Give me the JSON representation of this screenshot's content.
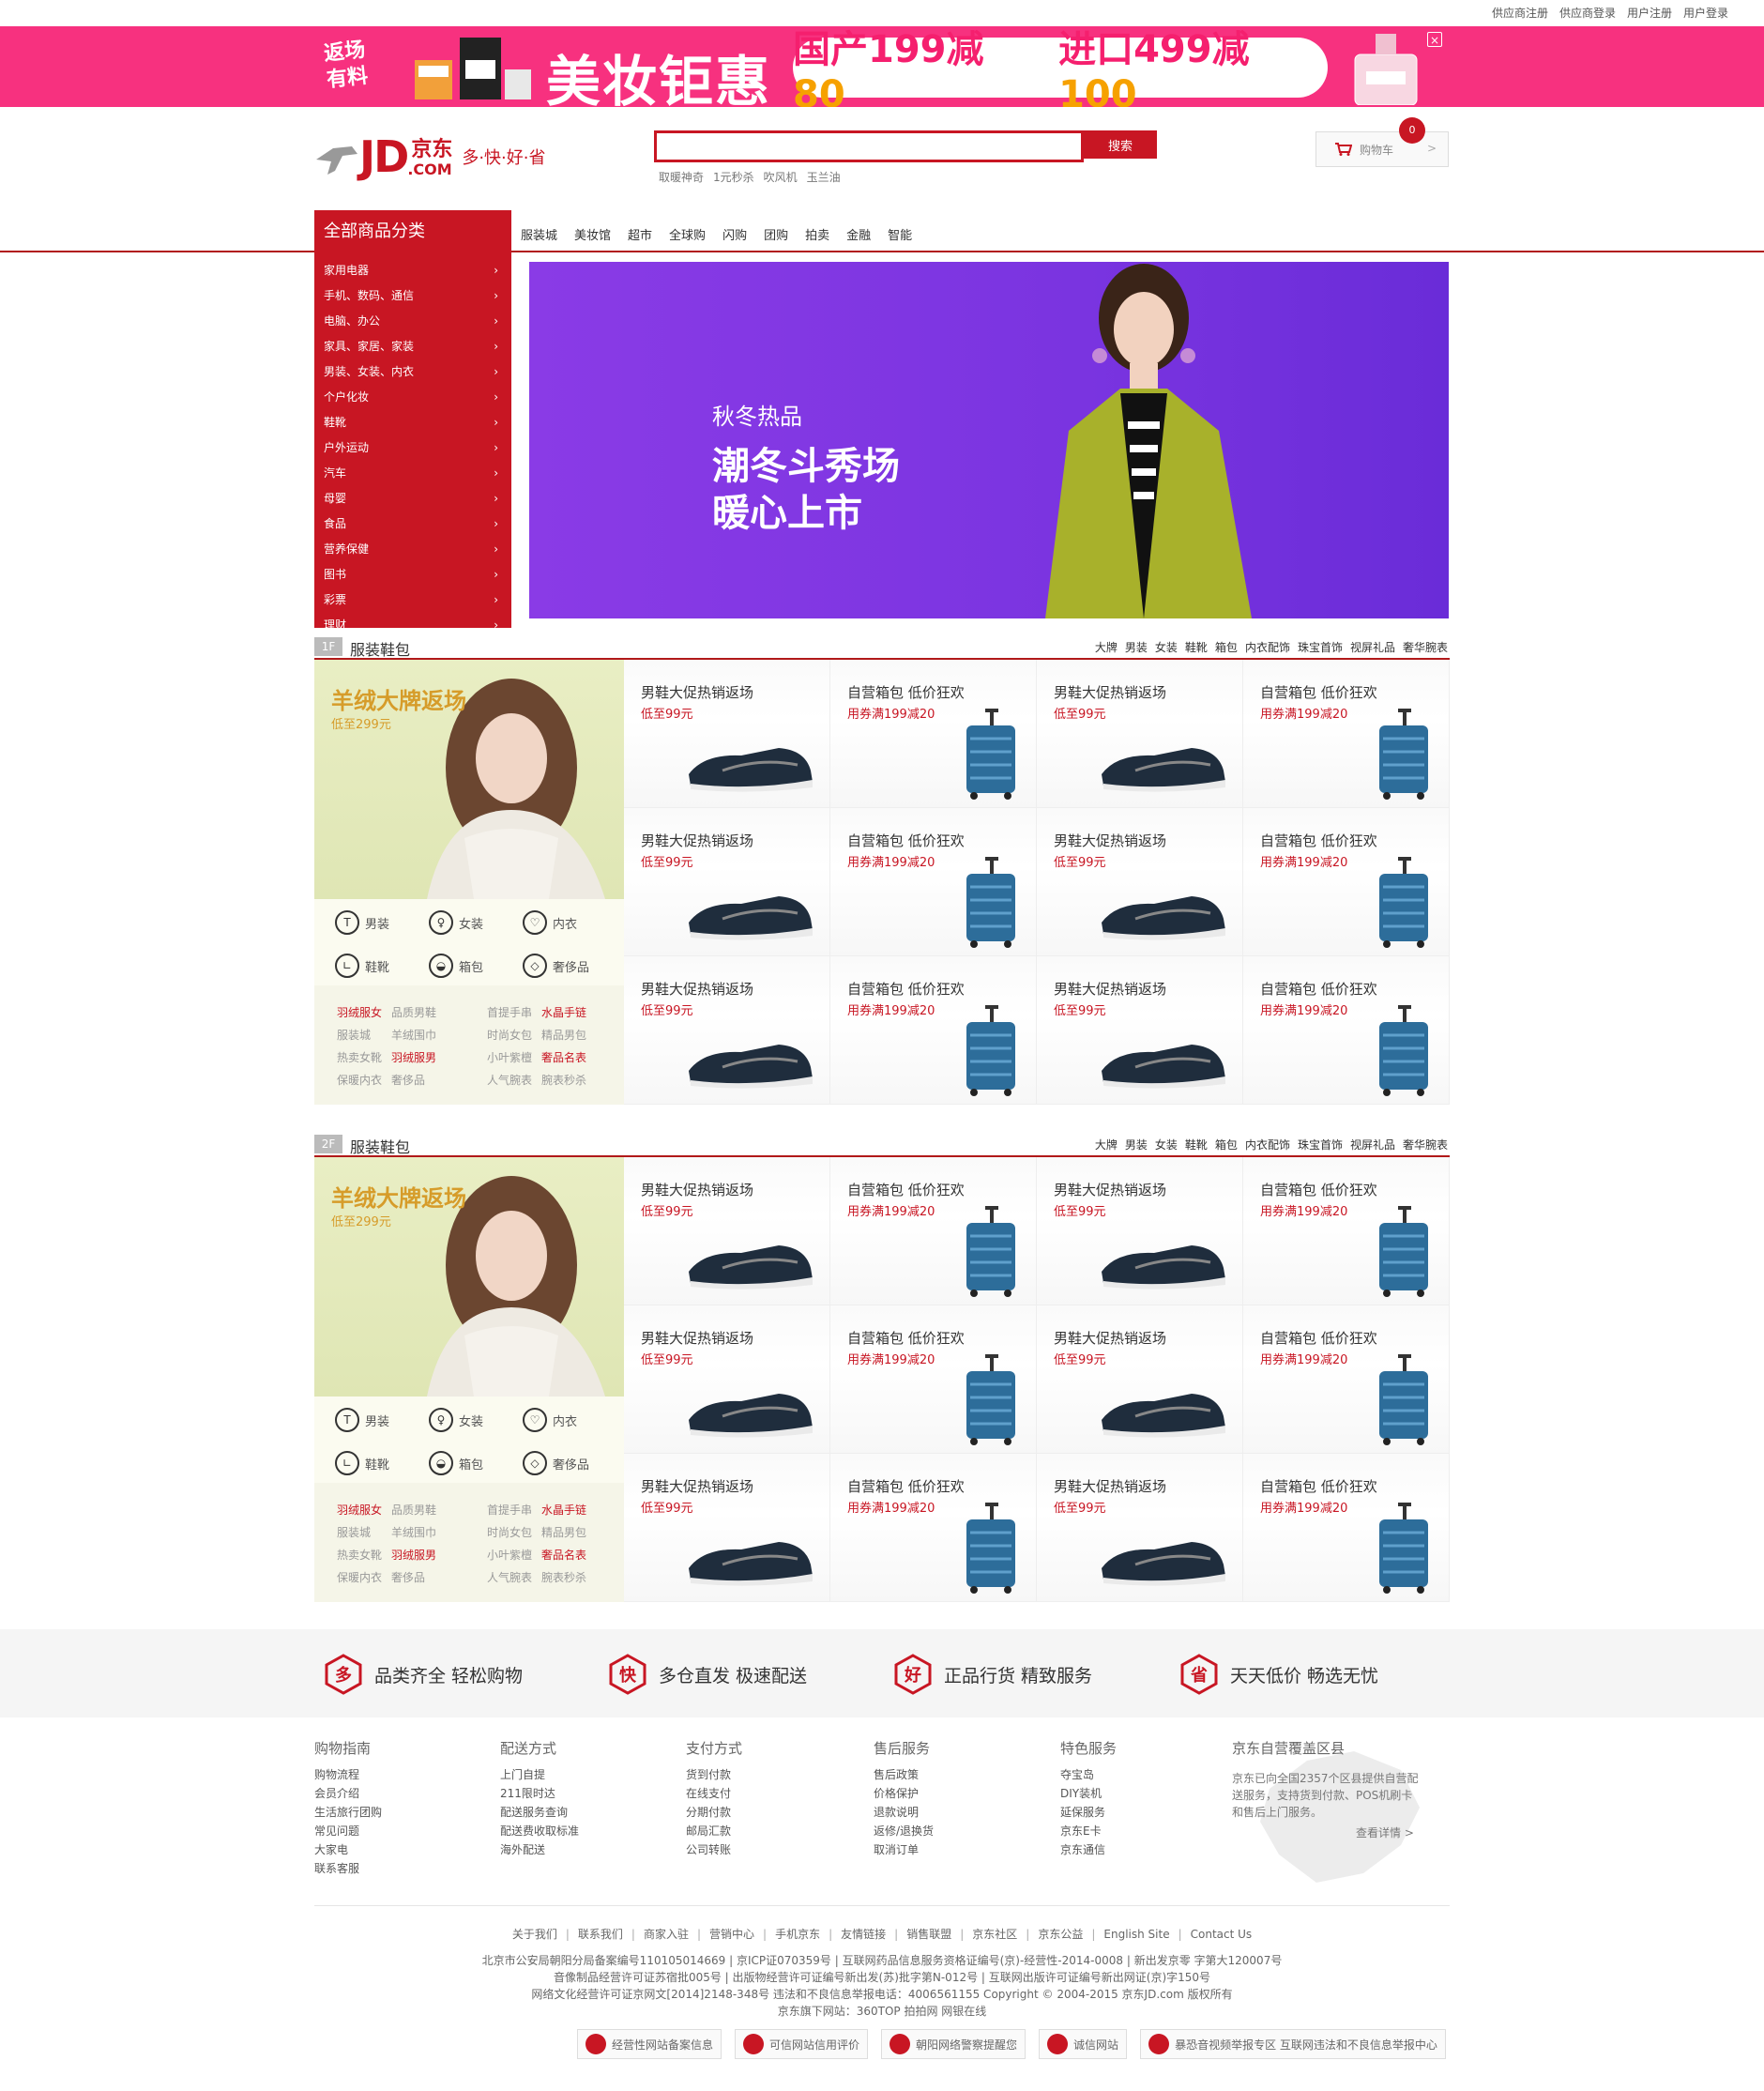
{
  "topbar": {
    "links": [
      "供应商注册",
      "供应商登录",
      "用户注册",
      "用户登录"
    ]
  },
  "promo": {
    "tag": "返场有料",
    "title": "美妆钜惠",
    "deal1_prefix": "国产199减",
    "deal1_value": "80",
    "deal2_prefix": "进口499减",
    "deal2_value": "100",
    "close": "×"
  },
  "header": {
    "logo_jd": "JD",
    "logo_cn": "京东",
    "logo_com": ".COM",
    "slogan": "多·快·好·省",
    "search_button": "搜索",
    "search_placeholder": "",
    "hotwords": [
      "取暖神奇",
      "1元秒杀",
      "吹风机",
      "玉兰油"
    ],
    "cart_label": "购物车",
    "cart_count": "0",
    "cart_arrow": ">"
  },
  "nav": {
    "title": "全部商品分类",
    "links": [
      "服装城",
      "美妆馆",
      "超市",
      "全球购",
      "闪购",
      "团购",
      "拍卖",
      "金融",
      "智能"
    ]
  },
  "categories": [
    "家用电器",
    "手机、数码、通信",
    "电脑、办公",
    "家具、家居、家装",
    "男装、女装、内衣",
    "个户化妆",
    "鞋靴",
    "户外运动",
    "汽车",
    "母婴",
    "食品",
    "营养保健",
    "图书",
    "彩票",
    "理财"
  ],
  "banner": {
    "line1": "秋冬热品",
    "line2": "潮冬斗秀场",
    "line3": "暖心上市"
  },
  "floors": [
    {
      "num": "1F",
      "name": "服装鞋包",
      "tabs": [
        "大牌",
        "男装",
        "女装",
        "鞋靴",
        "箱包",
        "内衣配饰",
        "珠宝首饰",
        "视屏礼品",
        "奢华腕表"
      ],
      "hero_title": "羊绒大牌返场",
      "hero_sub": "低至299元",
      "cats": [
        "男装",
        "女装",
        "内衣",
        "鞋靴",
        "箱包",
        "奢侈品"
      ],
      "keywords": [
        [
          "羽绒服女",
          "品质男鞋",
          "首提手串",
          "水晶手链"
        ],
        [
          "服装城",
          "羊绒围巾",
          "时尚女包",
          "精品男包"
        ],
        [
          "热卖女靴",
          "羽绒服男",
          "小叶紫檀",
          "奢品名表"
        ],
        [
          "保暖内衣",
          "奢侈品",
          "人气腕表",
          "腕表秒杀"
        ]
      ],
      "cells": [
        {
          "t": "男鞋大促热销返场",
          "s": "低至99元",
          "kind": "shoe"
        },
        {
          "t": "自营箱包 低价狂欢",
          "s": "用券满199减20",
          "kind": "bag"
        },
        {
          "t": "男鞋大促热销返场",
          "s": "低至99元",
          "kind": "shoe"
        },
        {
          "t": "自营箱包 低价狂欢",
          "s": "用券满199减20",
          "kind": "bag"
        },
        {
          "t": "男鞋大促热销返场",
          "s": "低至99元",
          "kind": "shoe"
        },
        {
          "t": "自营箱包 低价狂欢",
          "s": "用券满199减20",
          "kind": "bag"
        },
        {
          "t": "男鞋大促热销返场",
          "s": "低至99元",
          "kind": "shoe"
        },
        {
          "t": "自营箱包 低价狂欢",
          "s": "用券满199减20",
          "kind": "bag"
        },
        {
          "t": "男鞋大促热销返场",
          "s": "低至99元",
          "kind": "shoe"
        },
        {
          "t": "自营箱包 低价狂欢",
          "s": "用券满199减20",
          "kind": "bag"
        },
        {
          "t": "男鞋大促热销返场",
          "s": "低至99元",
          "kind": "shoe"
        },
        {
          "t": "自营箱包 低价狂欢",
          "s": "用券满199减20",
          "kind": "bag"
        }
      ]
    },
    {
      "num": "2F",
      "name": "服装鞋包",
      "tabs": [
        "大牌",
        "男装",
        "女装",
        "鞋靴",
        "箱包",
        "内衣配饰",
        "珠宝首饰",
        "视屏礼品",
        "奢华腕表"
      ],
      "hero_title": "羊绒大牌返场",
      "hero_sub": "低至299元",
      "cats": [
        "男装",
        "女装",
        "内衣",
        "鞋靴",
        "箱包",
        "奢侈品"
      ],
      "keywords": [
        [
          "羽绒服女",
          "品质男鞋",
          "首提手串",
          "水晶手链"
        ],
        [
          "服装城",
          "羊绒围巾",
          "时尚女包",
          "精品男包"
        ],
        [
          "热卖女靴",
          "羽绒服男",
          "小叶紫檀",
          "奢品名表"
        ],
        [
          "保暖内衣",
          "奢侈品",
          "人气腕表",
          "腕表秒杀"
        ]
      ],
      "cells": [
        {
          "t": "男鞋大促热销返场",
          "s": "低至99元",
          "kind": "shoe"
        },
        {
          "t": "自营箱包 低价狂欢",
          "s": "用券满199减20",
          "kind": "bag"
        },
        {
          "t": "男鞋大促热销返场",
          "s": "低至99元",
          "kind": "shoe"
        },
        {
          "t": "自营箱包 低价狂欢",
          "s": "用券满199减20",
          "kind": "bag"
        },
        {
          "t": "男鞋大促热销返场",
          "s": "低至99元",
          "kind": "shoe"
        },
        {
          "t": "自营箱包 低价狂欢",
          "s": "用券满199减20",
          "kind": "bag"
        },
        {
          "t": "男鞋大促热销返场",
          "s": "低至99元",
          "kind": "shoe"
        },
        {
          "t": "自营箱包 低价狂欢",
          "s": "用券满199减20",
          "kind": "bag"
        },
        {
          "t": "男鞋大促热销返场",
          "s": "低至99元",
          "kind": "shoe"
        },
        {
          "t": "自营箱包 低价狂欢",
          "s": "用券满199减20",
          "kind": "bag"
        },
        {
          "t": "男鞋大促热销返场",
          "s": "低至99元",
          "kind": "shoe"
        },
        {
          "t": "自营箱包 低价狂欢",
          "s": "用券满199减20",
          "kind": "bag"
        }
      ]
    }
  ],
  "features": [
    {
      "icon": "多",
      "text": "品类齐全  轻松购物"
    },
    {
      "icon": "快",
      "text": "多仓直发  极速配送"
    },
    {
      "icon": "好",
      "text": "正品行货  精致服务"
    },
    {
      "icon": "省",
      "text": "天天低价  畅选无忧"
    }
  ],
  "footer_cols": [
    {
      "title": "购物指南",
      "links": [
        "购物流程",
        "会员介绍",
        "生活旅行团购",
        "常见问题",
        "大家电",
        "联系客服"
      ]
    },
    {
      "title": "配送方式",
      "links": [
        "上门自提",
        "211限时达",
        "配送服务查询",
        "配送费收取标准",
        "海外配送"
      ]
    },
    {
      "title": "支付方式",
      "links": [
        "货到付款",
        "在线支付",
        "分期付款",
        "邮局汇款",
        "公司转账"
      ]
    },
    {
      "title": "售后服务",
      "links": [
        "售后政策",
        "价格保护",
        "退款说明",
        "返修/退换货",
        "取消订单"
      ]
    },
    {
      "title": "特色服务",
      "links": [
        "夺宝岛",
        "DIY装机",
        "延保服务",
        "京东E卡",
        "京东通信"
      ]
    }
  ],
  "coverage": {
    "title": "京东自营覆盖区县",
    "desc": "京东已向全国2357个区县提供自营配送服务，支持货到付款、POS机刷卡和售后上门服务。",
    "more": "查看详情 >"
  },
  "footer_nav": [
    "关于我们",
    "联系我们",
    "商家入驻",
    "营销中心",
    "手机京东",
    "友情链接",
    "销售联盟",
    "京东社区",
    "京东公益",
    "English Site",
    "Contact Us"
  ],
  "footer_info": [
    "北京市公安局朝阳分局备案编号110105014669 | 京ICP证070359号 | 互联网药品信息服务资格证编号(京)-经营性-2014-0008 | 新出发京零 字第大120007号",
    "音像制品经营许可证苏宿批005号 | 出版物经营许可证编号新出发(苏)批字第N-012号 | 互联网出版许可证编号新出网证(京)字150号",
    "网络文化经营许可证京网文[2014]2148-348号  违法和不良信息举报电话：4006561155  Copyright © 2004-2015  京东JD.com 版权所有",
    "京东旗下网站：360TOP  拍拍网  网银在线"
  ],
  "badges": [
    "经营性网站备案信息",
    "可信网站信用评价",
    "朝阳网络警察提醒您",
    "诚信网站",
    "暴恐音视频举报专区 互联网违法和不良信息举报中心"
  ]
}
